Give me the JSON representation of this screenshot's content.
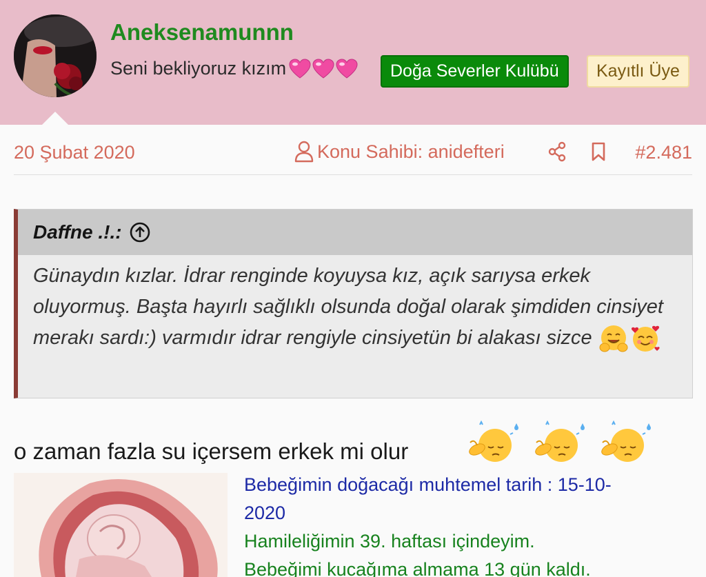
{
  "user": {
    "name": "Aneksenamunnn",
    "title_text": "Seni bekliyoruz kızım",
    "badge_group": "Doğa Severler Kulübü",
    "badge_status": "Kayıtlı Üye"
  },
  "meta": {
    "date": "20 Şubat 2020",
    "op_label": "Konu Sahibi: anidefteri",
    "post_number": "#2.481"
  },
  "quote": {
    "author": "Daffne .!.:",
    "text": "Günaydın kızlar. İdrar renginde koyuysa kız, açık sarıysa erkek oluyormuş. Başta hayırlı sağlıklı olsunda doğal olarak şimdiden cinsiyet merakı sardı:) varmıdır idrar rengiyle cinsiyetün bi alakası sizce"
  },
  "post": {
    "text": "o zaman fazla su içersem erkek mi olur"
  },
  "signature": {
    "line1": "Bebeğimin doğacağı muhtemel tarih : 15-10-",
    "line2": "2020",
    "line3": "Hamileliğimin 39. haftası içindeyim.",
    "line4": "Bebeğimi kucağıma almama 13 gün kaldı."
  },
  "colors": {
    "header_bg": "#e8bcc9",
    "username": "#1f8a1f",
    "meta_accent": "#d46a5c",
    "quote_border": "#8a3b35",
    "sig_blue": "#1d2aa6",
    "sig_green": "#17821e"
  },
  "icons": [
    "heart-icon",
    "user-icon",
    "share-icon",
    "bookmark-icon",
    "arrow-up-circle-icon",
    "hugging-face-emoji",
    "smiling-hearts-emoji",
    "sweat-face-emoji"
  ]
}
